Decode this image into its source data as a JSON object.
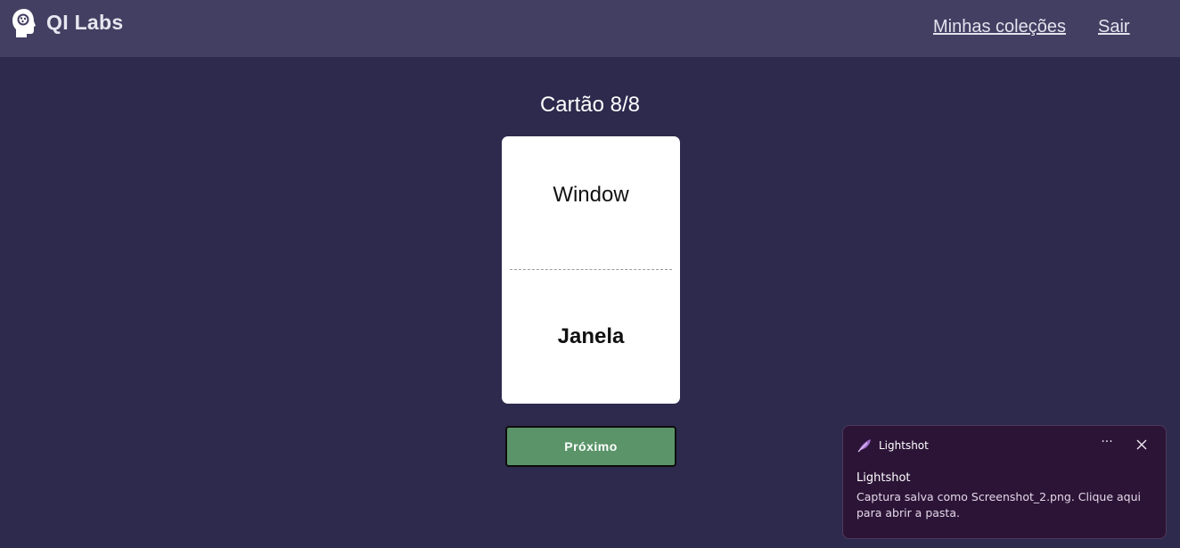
{
  "header": {
    "brand": "QI Labs",
    "logo_icon": "head-brain-icon",
    "nav": {
      "collections": "Minhas coleções",
      "logout": "Sair"
    }
  },
  "study": {
    "counter": "Cartão 8/8",
    "card": {
      "front": "Window",
      "back": "Janela"
    },
    "next_label": "Próximo"
  },
  "notification": {
    "app_name": "Lightshot",
    "app_icon": "feather-icon",
    "more_icon": "more-icon",
    "more_glyph": "···",
    "close_icon": "close-icon",
    "title": "Lightshot",
    "body": "Captura salva como Screenshot_2.png. Clique aqui para abrir a pasta."
  },
  "colors": {
    "background": "#2d2a4d",
    "header": "#433f62",
    "card": "#ffffff",
    "button": "#5a9468",
    "toast": "#2c1437"
  }
}
